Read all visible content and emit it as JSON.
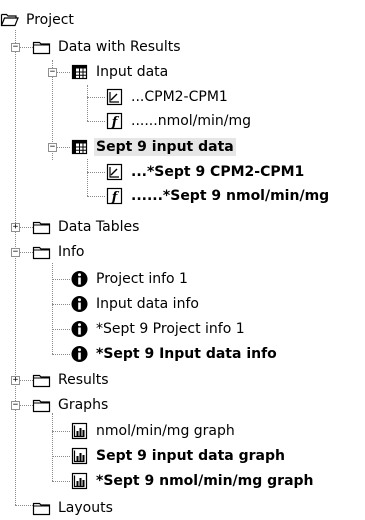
{
  "tree": {
    "root": {
      "label": "Project",
      "icon": "folder-open-icon"
    },
    "data_with_results": {
      "label": "Data with Results",
      "icon": "folder-icon",
      "expanded": true,
      "children": {
        "input_data": {
          "label": "Input data",
          "icon": "data-table-icon",
          "expanded": true,
          "children": {
            "cpm": {
              "label": "...CPM2-CPM1",
              "icon": "xy-chart-icon"
            },
            "nmol": {
              "label": "......nmol/min/mg",
              "icon": "function-icon"
            }
          }
        },
        "sept9_input": {
          "label": "Sept 9 input data",
          "icon": "data-table-icon",
          "expanded": true,
          "children": {
            "cpm": {
              "label": "...*Sept 9 CPM2-CPM1",
              "icon": "xy-chart-icon"
            },
            "nmol": {
              "label": "......*Sept 9 nmol/min/mg",
              "icon": "function-icon"
            }
          }
        }
      }
    },
    "data_tables": {
      "label": "Data Tables",
      "icon": "folder-icon",
      "expanded": false
    },
    "info": {
      "label": "Info",
      "icon": "folder-icon",
      "expanded": true,
      "children": [
        {
          "label": "Project info 1",
          "icon": "info-icon"
        },
        {
          "label": "Input data info",
          "icon": "info-icon"
        },
        {
          "label": "*Sept 9 Project info 1",
          "icon": "info-icon"
        },
        {
          "label": "*Sept 9 Input data info",
          "icon": "info-icon"
        }
      ]
    },
    "results": {
      "label": "Results",
      "icon": "folder-icon",
      "expanded": false
    },
    "graphs": {
      "label": "Graphs",
      "icon": "folder-icon",
      "expanded": true,
      "children": [
        {
          "label": "nmol/min/mg graph",
          "icon": "graph-icon"
        },
        {
          "label": "Sept 9 input data graph",
          "icon": "graph-icon"
        },
        {
          "label": "*Sept 9 nmol/min/mg graph",
          "icon": "graph-icon"
        }
      ]
    },
    "layouts": {
      "label": "Layouts",
      "icon": "folder-icon"
    },
    "expander_plus": "+",
    "expander_minus": "−"
  },
  "colors": {
    "folder_fill": "#ffffff",
    "folder_stroke": "#000000",
    "tree_line": "#8a8a8a",
    "selection": "#e6e6e6",
    "info_icon": "#000000"
  }
}
